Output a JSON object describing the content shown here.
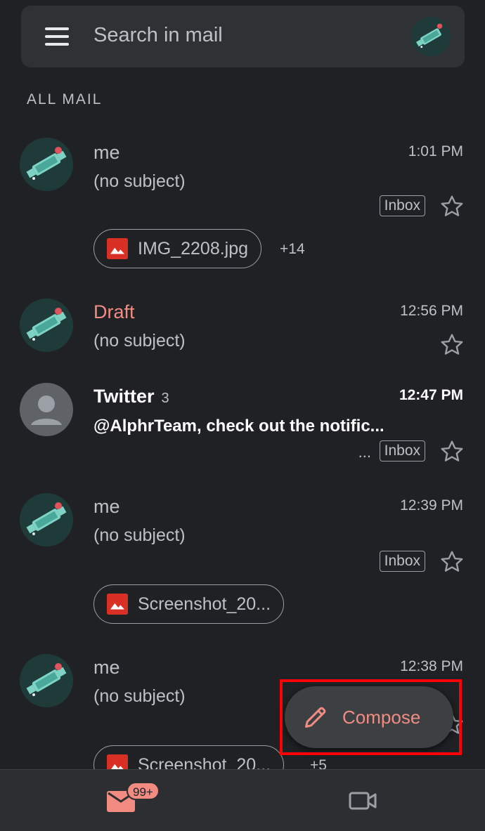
{
  "search": {
    "placeholder": "Search in mail"
  },
  "section": {
    "label": "ALL MAIL"
  },
  "messages": [
    {
      "sender": "me",
      "subject": "(no subject)",
      "time": "1:01 PM",
      "label": "Inbox",
      "attachment": "IMG_2208.jpg",
      "more": "+14"
    },
    {
      "sender": "Draft",
      "subject": "(no subject)",
      "time": "12:56 PM"
    },
    {
      "sender": "Twitter",
      "count": "3",
      "subject": "@AlphrTeam, check out the notific...",
      "time": "12:47 PM",
      "ellipsis": "...",
      "label": "Inbox"
    },
    {
      "sender": "me",
      "subject": "(no subject)",
      "time": "12:39 PM",
      "label": "Inbox",
      "attachment": "Screenshot_20..."
    },
    {
      "sender": "me",
      "subject": "(no subject)",
      "time": "12:38 PM",
      "attachment": "Screenshot_20...",
      "more": "+5"
    }
  ],
  "compose": {
    "label": "Compose"
  },
  "nav": {
    "mail_badge": "99+"
  },
  "colors": {
    "background": "#202124",
    "accent": "#f28b82",
    "surface": "#303134"
  },
  "icons": [
    "menu-icon",
    "account-avatar",
    "star-icon",
    "image-icon",
    "pencil-icon",
    "mail-icon",
    "video-icon"
  ]
}
